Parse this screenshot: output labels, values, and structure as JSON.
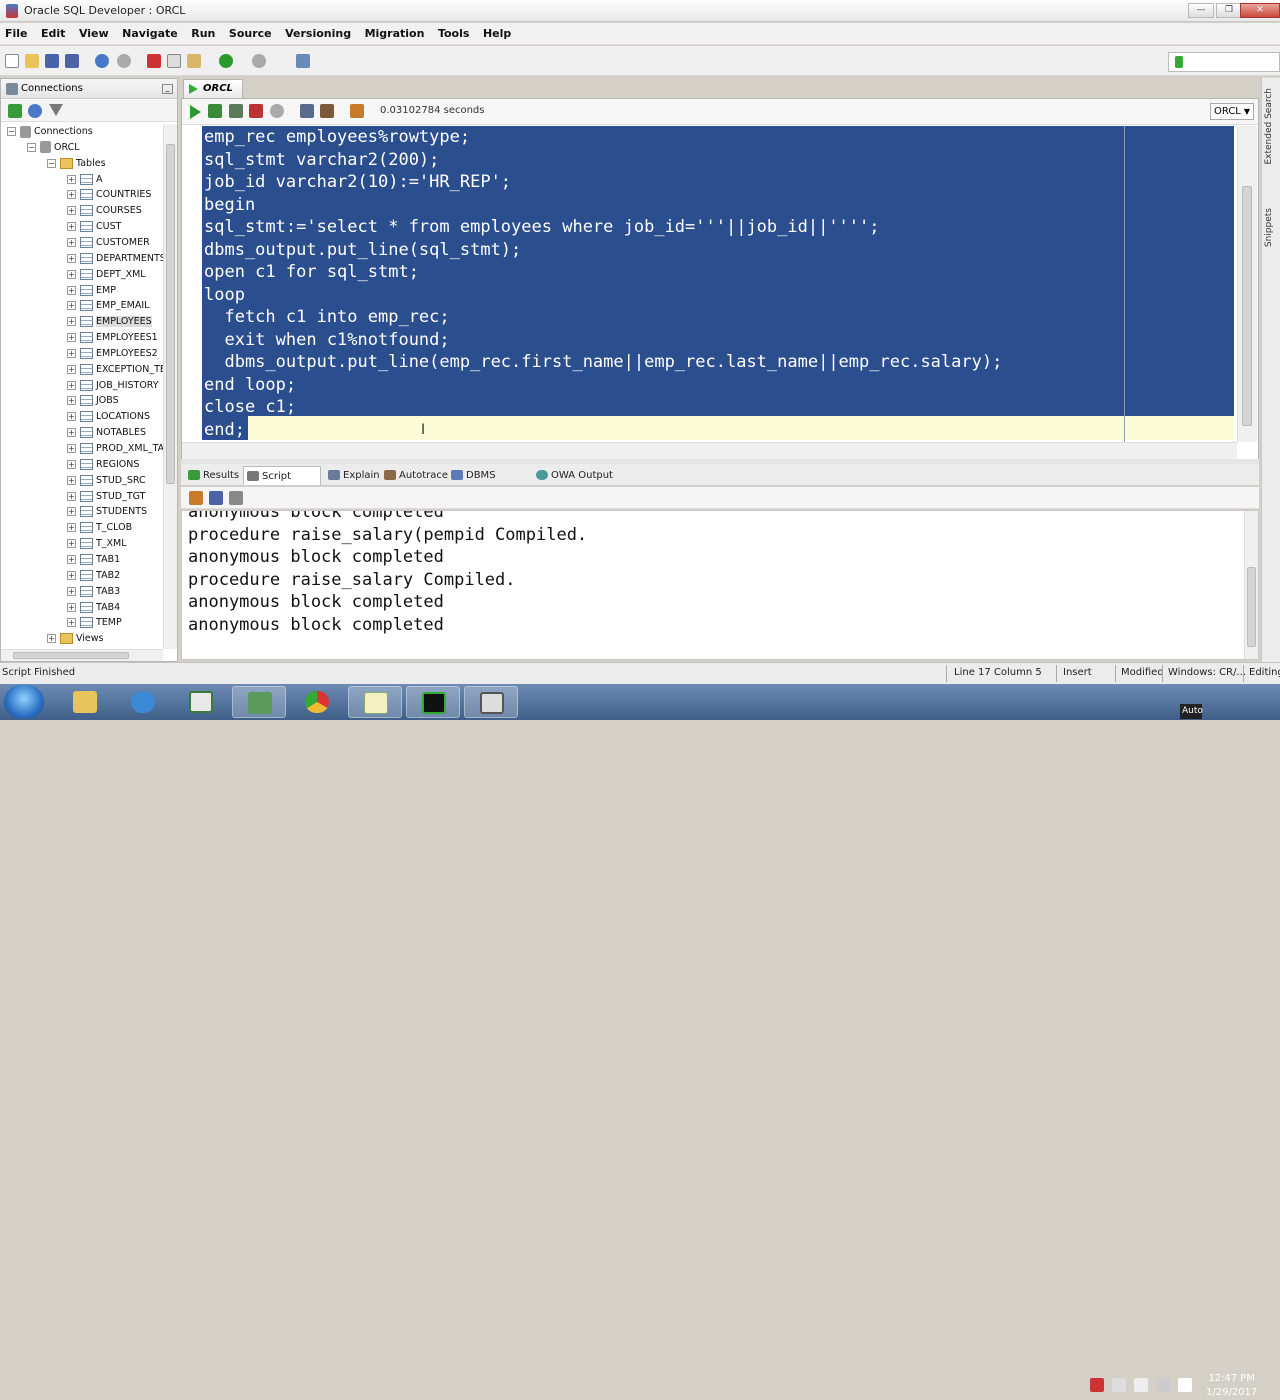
{
  "window": {
    "title": "Oracle SQL Developer : ORCL",
    "min": "—",
    "max": "❐",
    "close": "✕"
  },
  "menu": [
    "File",
    "Edit",
    "View",
    "Navigate",
    "Run",
    "Source",
    "Versioning",
    "Migration",
    "Tools",
    "Help"
  ],
  "connections_panel": {
    "header": "Connections",
    "tree": [
      {
        "label": "Connections",
        "indent": 0,
        "type": "db",
        "expander": "−"
      },
      {
        "label": "ORCL",
        "indent": 1,
        "type": "db",
        "expander": "−"
      },
      {
        "label": "Tables",
        "indent": 2,
        "type": "folder",
        "expander": "−"
      },
      {
        "label": "A",
        "indent": 3,
        "type": "table",
        "expander": "+"
      },
      {
        "label": "COUNTRIES",
        "indent": 3,
        "type": "table",
        "expander": "+"
      },
      {
        "label": "COURSES",
        "indent": 3,
        "type": "table",
        "expander": "+"
      },
      {
        "label": "CUST",
        "indent": 3,
        "type": "table",
        "expander": "+"
      },
      {
        "label": "CUSTOMER",
        "indent": 3,
        "type": "table",
        "expander": "+"
      },
      {
        "label": "DEPARTMENTS",
        "indent": 3,
        "type": "table",
        "expander": "+"
      },
      {
        "label": "DEPT_XML",
        "indent": 3,
        "type": "table",
        "expander": "+"
      },
      {
        "label": "EMP",
        "indent": 3,
        "type": "table",
        "expander": "+"
      },
      {
        "label": "EMP_EMAIL",
        "indent": 3,
        "type": "table",
        "expander": "+"
      },
      {
        "label": "EMPLOYEES",
        "indent": 3,
        "type": "table",
        "expander": "+",
        "selected": true
      },
      {
        "label": "EMPLOYEES1",
        "indent": 3,
        "type": "table",
        "expander": "+"
      },
      {
        "label": "EMPLOYEES2",
        "indent": 3,
        "type": "table",
        "expander": "+"
      },
      {
        "label": "EXCEPTION_TE",
        "indent": 3,
        "type": "table",
        "expander": "+"
      },
      {
        "label": "JOB_HISTORY",
        "indent": 3,
        "type": "table",
        "expander": "+"
      },
      {
        "label": "JOBS",
        "indent": 3,
        "type": "table",
        "expander": "+"
      },
      {
        "label": "LOCATIONS",
        "indent": 3,
        "type": "table",
        "expander": "+"
      },
      {
        "label": "NOTABLES",
        "indent": 3,
        "type": "table",
        "expander": "+"
      },
      {
        "label": "PROD_XML_TA",
        "indent": 3,
        "type": "table",
        "expander": "+"
      },
      {
        "label": "REGIONS",
        "indent": 3,
        "type": "table",
        "expander": "+"
      },
      {
        "label": "STUD_SRC",
        "indent": 3,
        "type": "table",
        "expander": "+"
      },
      {
        "label": "STUD_TGT",
        "indent": 3,
        "type": "table",
        "expander": "+"
      },
      {
        "label": "STUDENTS",
        "indent": 3,
        "type": "table",
        "expander": "+"
      },
      {
        "label": "T_CLOB",
        "indent": 3,
        "type": "table",
        "expander": "+"
      },
      {
        "label": "T_XML",
        "indent": 3,
        "type": "table",
        "expander": "+"
      },
      {
        "label": "TAB1",
        "indent": 3,
        "type": "table",
        "expander": "+"
      },
      {
        "label": "TAB2",
        "indent": 3,
        "type": "table",
        "expander": "+"
      },
      {
        "label": "TAB3",
        "indent": 3,
        "type": "table",
        "expander": "+"
      },
      {
        "label": "TAB4",
        "indent": 3,
        "type": "table",
        "expander": "+"
      },
      {
        "label": "TEMP",
        "indent": 3,
        "type": "table",
        "expander": "+"
      },
      {
        "label": "Views",
        "indent": 2,
        "type": "folder",
        "expander": "+"
      }
    ]
  },
  "editor": {
    "tab_label": "ORCL",
    "exec_time": "0.03102784 seconds",
    "connection": "ORCL",
    "lines": [
      "emp_rec employees%rowtype;",
      "sql_stmt varchar2(200);",
      "job_id varchar2(10):='HR_REP';",
      "begin",
      "sql_stmt:='select * from employees where job_id='''||job_id||'''';",
      "dbms_output.put_line(sql_stmt);",
      "open c1 for sql_stmt;",
      "loop",
      "  fetch c1 into emp_rec;",
      "  exit when c1%notfound;",
      "  dbms_output.put_line(emp_rec.first_name||emp_rec.last_name||emp_rec.salary);",
      "end loop;",
      "close c1;",
      "end;"
    ]
  },
  "output_tabs": [
    "Results",
    "Script Output",
    "Explain",
    "Autotrace",
    "DBMS Output",
    "OWA Output"
  ],
  "output_lines": [
    "anonymous block completed",
    "procedure raise_salary(pempid Compiled.",
    "anonymous block completed",
    "procedure raise_salary Compiled.",
    "anonymous block completed",
    "anonymous block completed"
  ],
  "side_tabs": [
    "Extended Search",
    "Snippets"
  ],
  "status": {
    "left": "Script Finished",
    "position": "Line 17 Column 5",
    "mode": "Insert",
    "modified": "Modified",
    "eol": "Windows: CR/...",
    "editing": "Editing"
  },
  "taskbar": {
    "time": "12:47 PM",
    "date": "1/29/2017",
    "lang": "Auto"
  }
}
